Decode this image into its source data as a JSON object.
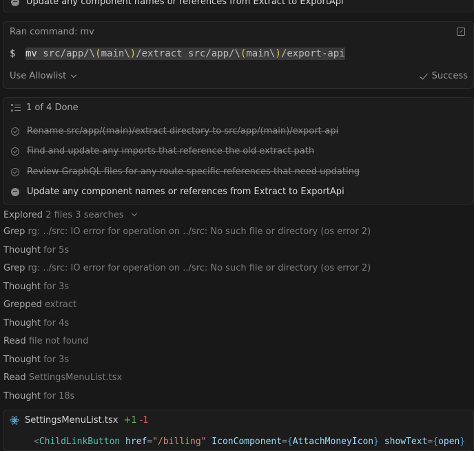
{
  "top_task": {
    "label": "Update any component names or references from Extract to ExportApi"
  },
  "command": {
    "header": "Ran command: mv",
    "prompt": "$",
    "cmd_mv": "mv",
    "cmd_a1": " src/app/\\",
    "cmd_p1": "(",
    "cmd_a2": "main\\",
    "cmd_p2": ")",
    "cmd_a3": "/extract src/app/\\",
    "cmd_p3": "(",
    "cmd_a4": "main\\",
    "cmd_p4": ")",
    "cmd_a5": "/export-api",
    "allowlist_label": "Use Allowlist",
    "status": "Success"
  },
  "todos": {
    "header": "1 of 4 Done",
    "items": [
      {
        "label": "Rename src/app/(main)/extract directory to src/app/(main)/export-api",
        "state": "done"
      },
      {
        "label": "Find and update any imports that reference the old extract path",
        "state": "done"
      },
      {
        "label": "Review GraphQL files for any route-specific references that need updating",
        "state": "done"
      },
      {
        "label": "Update any component names or references from Extract to ExportApi",
        "state": "in-progress"
      }
    ]
  },
  "log": {
    "explored": {
      "verb": "Explored",
      "detail": "2 files 3 searches"
    },
    "entries": [
      {
        "verb": "Grep",
        "detail": "rg: ../src: IO error for operation on ../src: No such file or directory (os error 2)"
      },
      {
        "verb": "Thought",
        "detail": "for 5s"
      },
      {
        "verb": "Grep",
        "detail": "rg: ../src: IO error for operation on ../src: No such file or directory (os error 2)"
      },
      {
        "verb": "Thought",
        "detail": "for 3s"
      },
      {
        "verb": "Grepped",
        "detail": "extract"
      },
      {
        "verb": "Thought",
        "detail": "for 4s"
      },
      {
        "verb": "Read",
        "detail": "file not found"
      },
      {
        "verb": "Thought",
        "detail": "for 3s"
      },
      {
        "verb": "Read",
        "detail": "SettingsMenuList.tsx"
      },
      {
        "verb": "Thought",
        "detail": "for 18s"
      }
    ]
  },
  "file": {
    "name": "SettingsMenuList.tsx",
    "added": "+1",
    "removed": "-1",
    "code": {
      "lt": "<",
      "tag": "ChildLinkButton",
      "attr1": " href",
      "eq1": "=",
      "str1": "\"/billing\"",
      "attr2": " IconComponent",
      "eq2": "=",
      "br1o": "{",
      "val2": "AttachMoneyIcon",
      "br1c": "}",
      "attr3": " showText",
      "eq3": "=",
      "br2o": "{",
      "val3": "open",
      "br2c": "}"
    }
  },
  "colors": {
    "background": "#181818",
    "card": "#1c1c1c",
    "success": "#9a9a9a",
    "added": "#6bbf59",
    "removed": "#d65c5c",
    "react": "#5aa7d8"
  }
}
